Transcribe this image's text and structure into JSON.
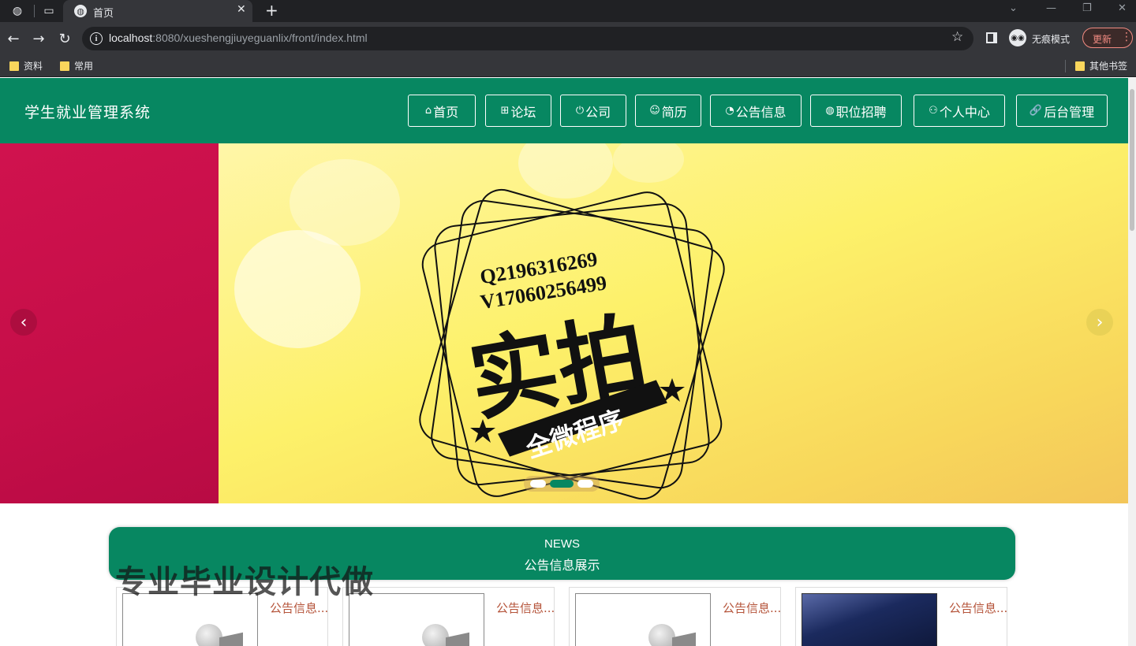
{
  "browser": {
    "tab_title": "首页",
    "url_host": "localhost",
    "url_rest": ":8080/xueshengjiuyeguanlix/front/index.html",
    "incognito_label": "无痕模式",
    "update_label": "更新",
    "bookmarks": [
      "资料",
      "常用"
    ],
    "other_bookmarks": "其他书签"
  },
  "site": {
    "title": "学生就业管理系统",
    "nav": [
      {
        "label": "首页",
        "icon": "home-icon",
        "glyph": "⌂"
      },
      {
        "label": "论坛",
        "icon": "forum-icon",
        "glyph": "⊞"
      },
      {
        "label": "公司",
        "icon": "company-icon",
        "glyph": "⏻"
      },
      {
        "label": "简历",
        "icon": "resume-icon",
        "glyph": "☺"
      },
      {
        "label": "公告信息",
        "icon": "announcement-icon",
        "glyph": "◔"
      },
      {
        "label": "职位招聘",
        "icon": "jobs-icon",
        "glyph": "◍"
      },
      {
        "label": "个人中心",
        "icon": "user-icon",
        "glyph": "⚇"
      },
      {
        "label": "后台管理",
        "icon": "link-icon",
        "glyph": "🔗"
      }
    ],
    "active_nav": 0
  },
  "banner": {
    "contact_q": "Q2196316269",
    "contact_v": "V17060256499",
    "headline": "实拍",
    "ribbon": "全微程序",
    "active_slide": 1,
    "slide_count": 3
  },
  "news": {
    "heading_en": "NEWS",
    "heading_cn": "公告信息展示",
    "cards": [
      {
        "title": "公告信息..."
      },
      {
        "title": "公告信息..."
      },
      {
        "title": "公告信息..."
      },
      {
        "title": "公告信息..."
      }
    ]
  },
  "watermark": "专业毕业设计代做",
  "colors": {
    "header_green": "#078761",
    "active_nav": "#2cb573",
    "banner_left": "#c50e48",
    "banner_yellow": "#fdf16a",
    "card_title": "#b5543a"
  }
}
